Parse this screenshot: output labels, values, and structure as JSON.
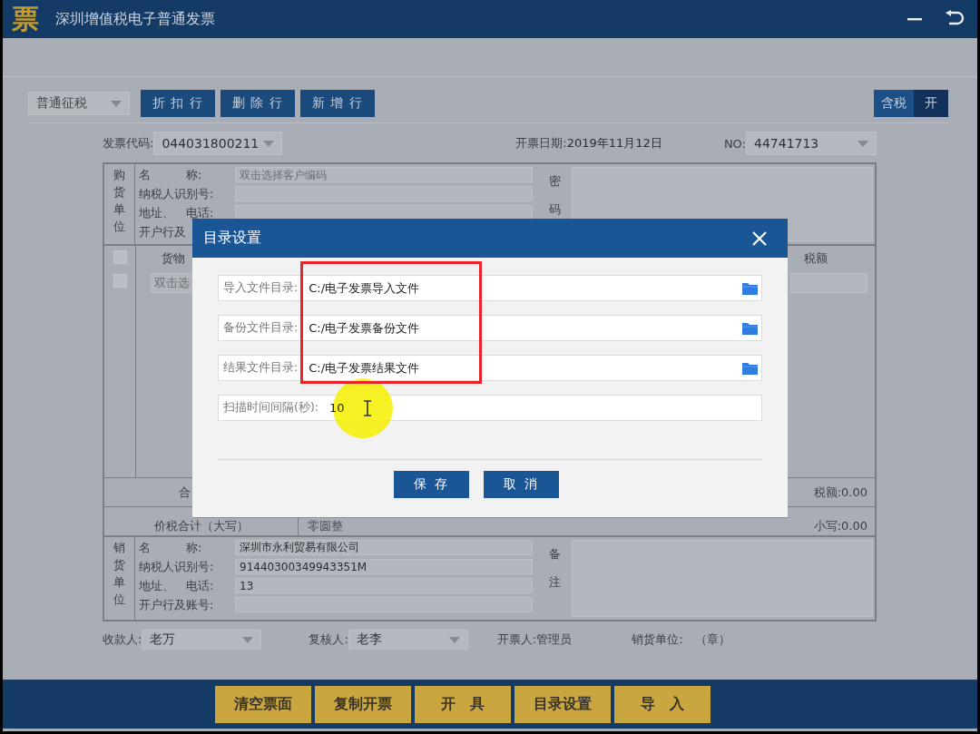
{
  "window": {
    "logo": "票",
    "title": "深圳增值税电子普通发票"
  },
  "toolbar": {
    "tax_type": "普通征税",
    "buttons": [
      "折 扣 行",
      "删 除 行",
      "新 增 行"
    ],
    "tax_toggle": {
      "label": "含税",
      "value": "开"
    }
  },
  "header": {
    "code_label": "发票代码:",
    "code": "044031800211",
    "date_label": "开票日期:",
    "date": "2019年11月12日",
    "no_label": "NO:",
    "no": "44741713"
  },
  "buyer": {
    "side_label": "购货单位",
    "fields": [
      {
        "kind": "field",
        "label": "名　　　称:",
        "placeholder": "双击选择客户编码"
      },
      {
        "kind": "field",
        "label": "纳税人识别号:"
      },
      {
        "kind": "field",
        "label": "地址、　电话:"
      },
      {
        "kind": "label",
        "label": "开户行及"
      }
    ],
    "secret_label": "密码"
  },
  "items": {
    "column_1": "货物",
    "tax_header": "税额",
    "placeholder": "双击选",
    "rows": [
      {
        "checked": false
      },
      {
        "checked": false
      }
    ]
  },
  "totals": {
    "label": "合",
    "tax": "税额:0.00",
    "grand_label": "价税合计（大写）",
    "grand_words": "零圆整",
    "small": "小写:0.00"
  },
  "seller": {
    "side_label": "销货单位",
    "fields": [
      {
        "label": "名　　　称:",
        "value": "深圳市永利贸易有限公司"
      },
      {
        "label": "纳税人识别号:",
        "value": "91440300349943351M"
      },
      {
        "label": "地址、　电话:",
        "value": "13"
      },
      {
        "label": "开户行及账号:"
      }
    ],
    "remark_label": "备注"
  },
  "signatures": {
    "payee_label": "收款人:",
    "payee": "老万",
    "reviewer_label": "复核人:",
    "reviewer": "老李",
    "issuer": "开票人:管理员",
    "seal": "销货单位:　（章）"
  },
  "bottom_buttons": [
    "清空票面",
    "复制开票",
    "开　具",
    "目录设置",
    "导　入"
  ],
  "dialog": {
    "title": "目录设置",
    "fields": [
      {
        "kind": "folder",
        "label": "导入文件目录:",
        "value": "C:/电子发票导入文件"
      },
      {
        "kind": "folder",
        "label": "备份文件目录:",
        "value": "C:/电子发票备份文件"
      },
      {
        "kind": "folder",
        "label": "结果文件目录:",
        "value": "C:/电子发票结果文件"
      },
      {
        "kind": "number",
        "label": "扫描时间间隔(秒):",
        "value": "10"
      }
    ],
    "buttons": [
      "保 存",
      "取 消"
    ]
  }
}
